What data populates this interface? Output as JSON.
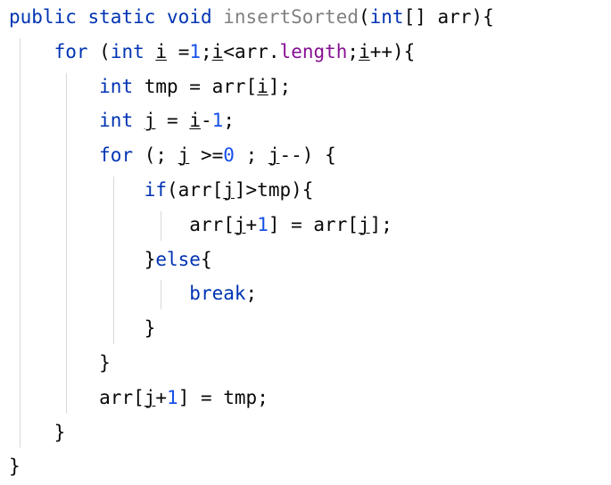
{
  "editor": {
    "language": "Java",
    "theme": "IntelliJ Light",
    "background_color": "#ffffff",
    "colors": {
      "keyword": "#0033b3",
      "number": "#1750eb",
      "field": "#871094",
      "method_declaration": "#808080",
      "default_text": "#080808",
      "indent_guide": "#d8d8d8"
    },
    "indent_guides_x": [
      22,
      74,
      127,
      180,
      233
    ],
    "code_text": "public static void insertSorted(int[] arr){\n    for (int i =1;i<arr.length;i++){\n        int tmp = arr[i];\n        int j = i-1;\n        for (; j >=0 ; j--) {\n            if(arr[j]>tmp){\n                arr[j+1] = arr[j];\n            }else{\n                break;\n            }\n        }\n        arr[j+1] = tmp;\n    }\n}",
    "lines": [
      {
        "indent": 0,
        "tokens": [
          {
            "t": "public",
            "c": "kw"
          },
          {
            "t": " ",
            "c": "txt"
          },
          {
            "t": "static",
            "c": "kw"
          },
          {
            "t": " ",
            "c": "txt"
          },
          {
            "t": "void",
            "c": "kw"
          },
          {
            "t": " ",
            "c": "txt"
          },
          {
            "t": "insertSorted",
            "c": "mth"
          },
          {
            "t": "(",
            "c": "txt"
          },
          {
            "t": "int",
            "c": "kw"
          },
          {
            "t": "[] arr){",
            "c": "txt"
          }
        ]
      },
      {
        "indent": 1,
        "tokens": [
          {
            "t": "for",
            "c": "kw"
          },
          {
            "t": " (",
            "c": "txt"
          },
          {
            "t": "int",
            "c": "kw"
          },
          {
            "t": " ",
            "c": "txt"
          },
          {
            "t": "i",
            "c": "und"
          },
          {
            "t": " =",
            "c": "txt"
          },
          {
            "t": "1",
            "c": "num"
          },
          {
            "t": ";",
            "c": "txt"
          },
          {
            "t": "i",
            "c": "und"
          },
          {
            "t": "<arr.",
            "c": "txt"
          },
          {
            "t": "length",
            "c": "fld"
          },
          {
            "t": ";",
            "c": "txt"
          },
          {
            "t": "i",
            "c": "und"
          },
          {
            "t": "++){",
            "c": "txt"
          }
        ]
      },
      {
        "indent": 2,
        "tokens": [
          {
            "t": "int",
            "c": "kw"
          },
          {
            "t": " tmp = arr[",
            "c": "txt"
          },
          {
            "t": "i",
            "c": "und"
          },
          {
            "t": "];",
            "c": "txt"
          }
        ]
      },
      {
        "indent": 2,
        "tokens": [
          {
            "t": "int",
            "c": "kw"
          },
          {
            "t": " ",
            "c": "txt"
          },
          {
            "t": "j",
            "c": "und"
          },
          {
            "t": " = ",
            "c": "txt"
          },
          {
            "t": "i",
            "c": "und"
          },
          {
            "t": "-",
            "c": "txt"
          },
          {
            "t": "1",
            "c": "num"
          },
          {
            "t": ";",
            "c": "txt"
          }
        ]
      },
      {
        "indent": 2,
        "tokens": [
          {
            "t": "for",
            "c": "kw"
          },
          {
            "t": " (; ",
            "c": "txt"
          },
          {
            "t": "j",
            "c": "und"
          },
          {
            "t": " >=",
            "c": "txt"
          },
          {
            "t": "0",
            "c": "num"
          },
          {
            "t": " ; ",
            "c": "txt"
          },
          {
            "t": "j",
            "c": "und"
          },
          {
            "t": "--) {",
            "c": "txt"
          }
        ]
      },
      {
        "indent": 3,
        "tokens": [
          {
            "t": "if",
            "c": "kw"
          },
          {
            "t": "(arr[",
            "c": "txt"
          },
          {
            "t": "j",
            "c": "und"
          },
          {
            "t": "]>tmp){",
            "c": "txt"
          }
        ]
      },
      {
        "indent": 4,
        "tokens": [
          {
            "t": "arr[",
            "c": "txt"
          },
          {
            "t": "j",
            "c": "und"
          },
          {
            "t": "+",
            "c": "txt"
          },
          {
            "t": "1",
            "c": "num"
          },
          {
            "t": "] = arr[",
            "c": "txt"
          },
          {
            "t": "j",
            "c": "und"
          },
          {
            "t": "];",
            "c": "txt"
          }
        ]
      },
      {
        "indent": 3,
        "tokens": [
          {
            "t": "}",
            "c": "txt"
          },
          {
            "t": "else",
            "c": "kw"
          },
          {
            "t": "{",
            "c": "txt"
          }
        ]
      },
      {
        "indent": 4,
        "tokens": [
          {
            "t": "break",
            "c": "kw"
          },
          {
            "t": ";",
            "c": "txt"
          }
        ]
      },
      {
        "indent": 3,
        "tokens": [
          {
            "t": "}",
            "c": "txt"
          }
        ]
      },
      {
        "indent": 2,
        "tokens": [
          {
            "t": "}",
            "c": "txt"
          }
        ]
      },
      {
        "indent": 2,
        "tokens": [
          {
            "t": "arr[",
            "c": "txt"
          },
          {
            "t": "j",
            "c": "und"
          },
          {
            "t": "+",
            "c": "txt"
          },
          {
            "t": "1",
            "c": "num"
          },
          {
            "t": "] = tmp;",
            "c": "txt"
          }
        ]
      },
      {
        "indent": 1,
        "tokens": [
          {
            "t": "}",
            "c": "txt"
          }
        ]
      },
      {
        "indent": 0,
        "tokens": [
          {
            "t": "}",
            "c": "txt"
          }
        ]
      }
    ]
  }
}
